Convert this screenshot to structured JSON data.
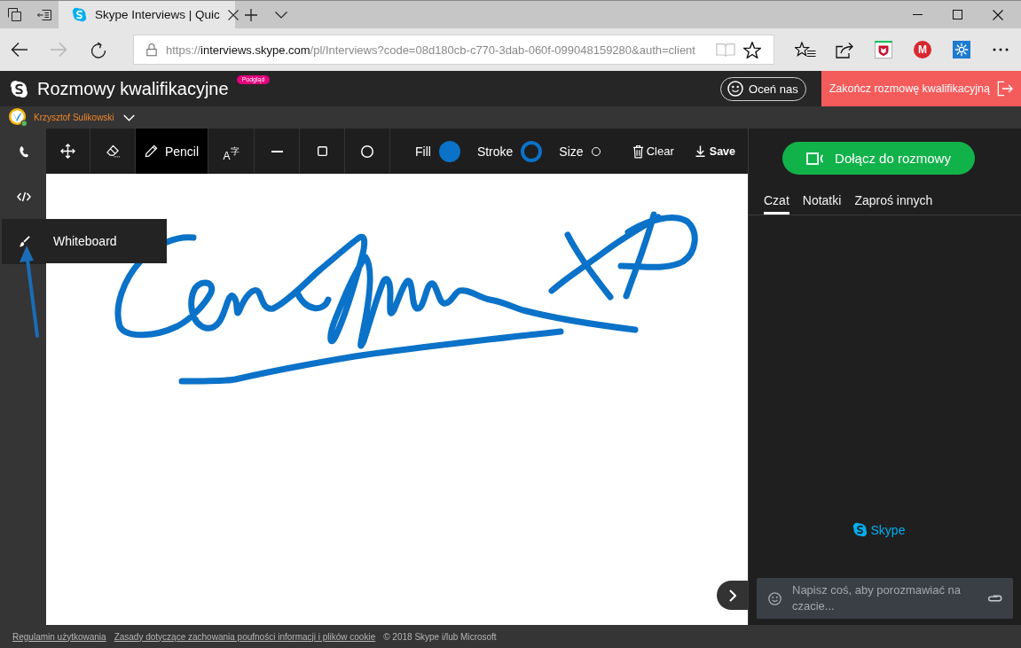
{
  "browser": {
    "tabs": [
      {
        "title": "Skype Interviews | Quic",
        "selected": true
      }
    ],
    "nav": [
      {
        "kind": "back",
        "disabled": false
      },
      {
        "kind": "forward",
        "disabled": true
      },
      {
        "kind": "refresh",
        "disabled": false
      }
    ],
    "address": {
      "scheme": "https://",
      "host": "interviews.skype.com",
      "path": "/pl/Interviews?code=08d180cb-c770-3dab-060f-099048159280&auth=client",
      "actions": [
        {
          "kind": "reading-view",
          "disabled": true
        },
        {
          "kind": "favorite",
          "disabled": false
        }
      ]
    },
    "toolbar": [
      {
        "kind": "favorites"
      },
      {
        "kind": "share"
      },
      {
        "kind": "shield"
      },
      {
        "kind": "letter",
        "label": "M"
      },
      {
        "kind": "snowflake"
      },
      {
        "kind": "more"
      }
    ]
  },
  "app": {
    "title": "Rozmowy kwalifikacyjne",
    "badge": "Podgląd",
    "rate_button": "Oceń nas",
    "end_button": "Zakończ rozmowę kwalifikacyjną",
    "user": "Krzysztof Sulikowski"
  },
  "sidebar": {
    "items": [
      {
        "kind": "phone",
        "selected": false
      },
      {
        "kind": "code",
        "selected": false
      },
      {
        "kind": "brush",
        "selected": true,
        "tooltip": "Whiteboard"
      }
    ]
  },
  "whiteboard": {
    "tools": [
      {
        "kind": "move",
        "selected": false
      },
      {
        "kind": "eraser",
        "selected": false
      },
      {
        "kind": "pencil",
        "label": "Pencil",
        "selected": true
      },
      {
        "kind": "text",
        "label": "A$^{字}$",
        "selected": false
      },
      {
        "kind": "line",
        "selected": false
      },
      {
        "kind": "rectangle",
        "selected": false
      },
      {
        "kind": "ellipse",
        "selected": false
      }
    ],
    "fill": {
      "label": "Fill",
      "color": "#0a72c8"
    },
    "stroke": {
      "label": "Stroke",
      "color": "#0a72c8"
    },
    "size": {
      "label": "Size"
    },
    "clear": "Clear",
    "save": "Save"
  },
  "chat_panel": {
    "join_button": "Dołącz do rozmowy",
    "tabs": [
      {
        "label": "Czat",
        "selected": true
      },
      {
        "label": "Notatki",
        "selected": false
      },
      {
        "label": "Zaproś innych",
        "selected": false
      }
    ],
    "brand": "Skype",
    "input": {
      "placeholder": "Napisz coś, aby porozmawiać na czacie..."
    }
  },
  "footer": {
    "links": [
      "Regulamin użytkowania",
      "Zasady dotyczące zachowania poufności informacji i plików cookie"
    ],
    "copyright": "© 2018 Skype i/lub Microsoft"
  }
}
